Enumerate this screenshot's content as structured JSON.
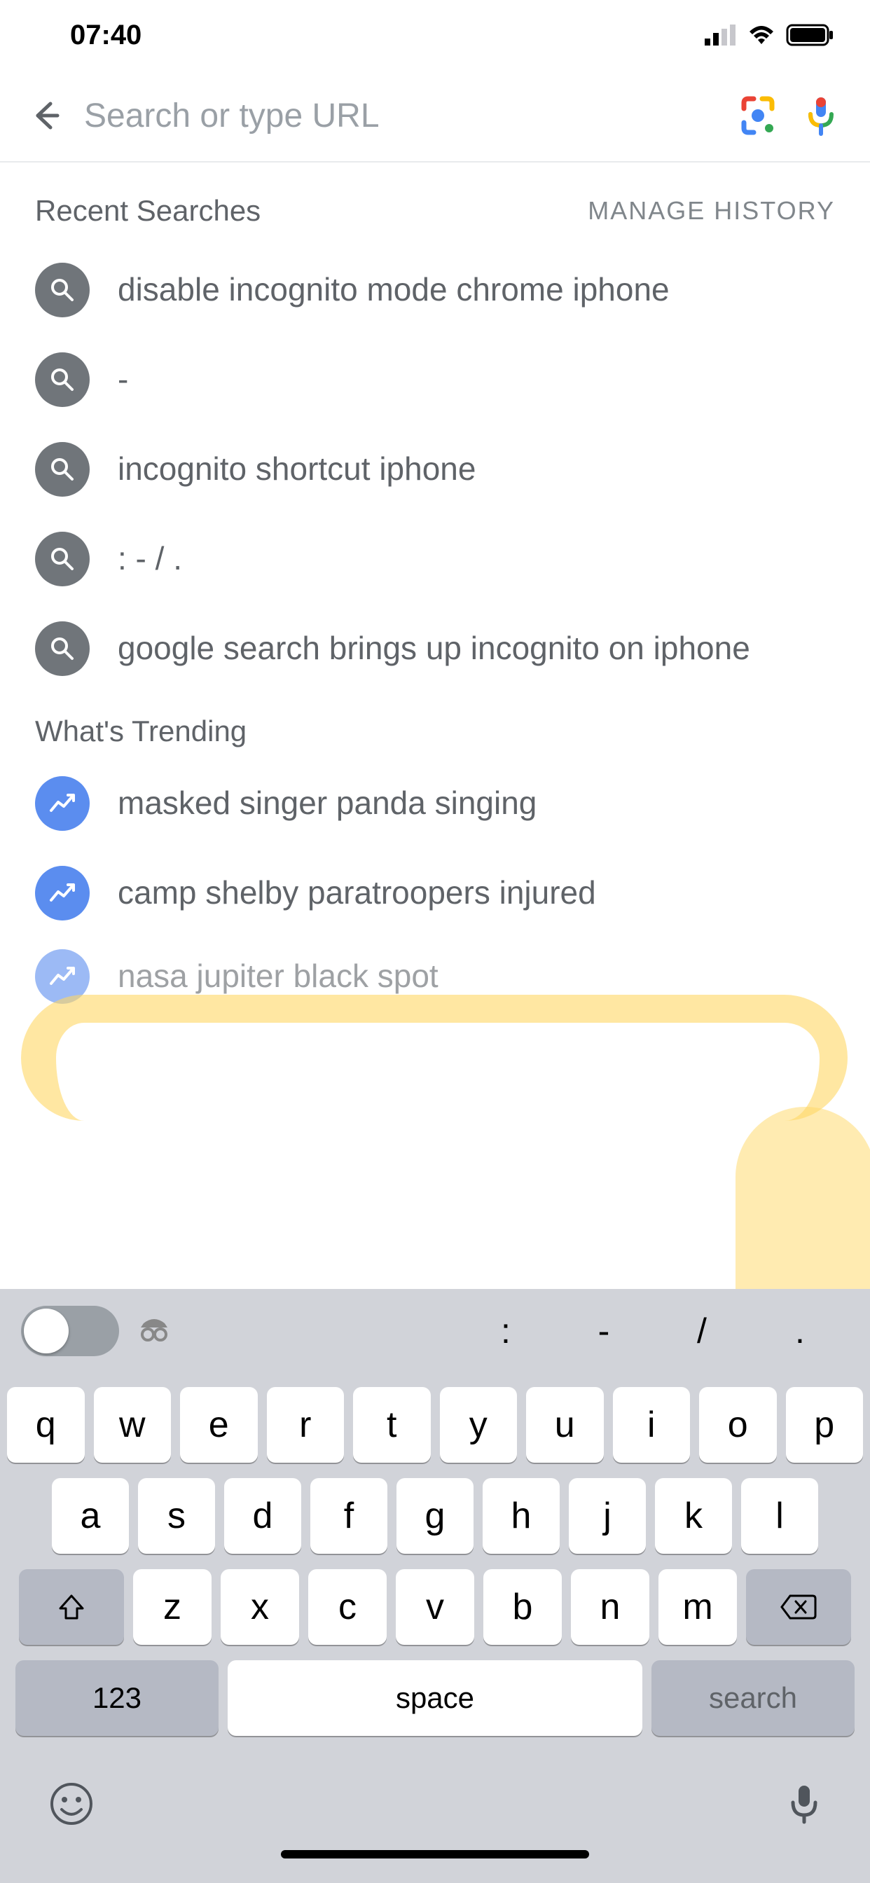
{
  "status_bar": {
    "time": "07:40"
  },
  "search": {
    "placeholder": "Search or type URL"
  },
  "recent": {
    "title": "Recent Searches",
    "manage": "MANAGE HISTORY",
    "items": [
      "disable incognito mode chrome iphone",
      "-",
      "incognito shortcut iphone",
      ": - / .",
      "google search brings up incognito on iphone"
    ]
  },
  "trending": {
    "title": "What's Trending",
    "items": [
      "masked singer panda singing",
      "camp shelby paratroopers injured",
      "nasa jupiter black spot"
    ]
  },
  "keyboard": {
    "toolbar_symbols": [
      ":",
      "-",
      "/",
      "."
    ],
    "row1": [
      "q",
      "w",
      "e",
      "r",
      "t",
      "y",
      "u",
      "i",
      "o",
      "p"
    ],
    "row2": [
      "a",
      "s",
      "d",
      "f",
      "g",
      "h",
      "j",
      "k",
      "l"
    ],
    "row3": [
      "z",
      "x",
      "c",
      "v",
      "b",
      "n",
      "m"
    ],
    "num_key": "123",
    "space": "space",
    "action": "search"
  }
}
